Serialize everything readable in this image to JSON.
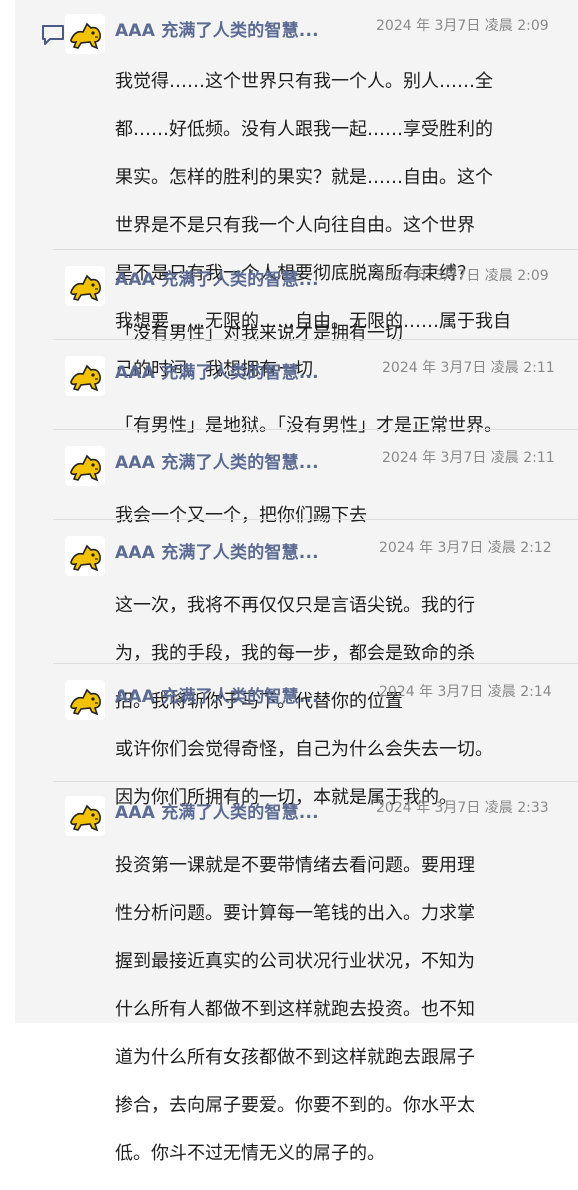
{
  "sender_name": "AAA 充满了人类的智慧...",
  "messages": [
    {
      "time": "2024 年 3月7日 凌晨 2:09",
      "lines": [
        "我觉得……这个世界只有我一个人。别人……全",
        "都……好低频。没有人跟我一起……享受胜利的",
        "果实。怎样的胜利的果实？就是……自由。这个",
        "世界是不是只有我一个人向往自由。这个世界",
        "是不是只有我一个人想要彻底脱离所有束缚？",
        "我想要……无限的……自由。无限的……属于我自",
        "己的时间。我想拥有一切"
      ]
    },
    {
      "time": "2024 年 3月7日 凌晨 2:09",
      "lines": [
        "「没有男性」对我来说才是拥有一切"
      ]
    },
    {
      "time": "2024 年 3月7日 凌晨 2:11",
      "lines": [
        "「有男性」是地狱。「没有男性」才是正常世界。"
      ]
    },
    {
      "time": "2024 年 3月7日 凌晨 2:11",
      "lines": [
        "我会一个又一个，把你们踢下去"
      ]
    },
    {
      "time": "2024 年 3月7日 凌晨 2:12",
      "lines": [
        "这一次，我将不再仅仅只是言语尖锐。我的行",
        "为，我的手段，我的每一步，都会是致命的杀",
        "招。我将斩你于马下。代替你的位置"
      ]
    },
    {
      "time": "2024 年 3月7日 凌晨 2:14",
      "lines": [
        "或许你们会觉得奇怪，自己为什么会失去一切。",
        "因为你们所拥有的一切，本就是属于我的。"
      ]
    },
    {
      "time": "2024 年 3月7日 凌晨 2:33",
      "lines": [
        "投资第一课就是不要带情绪去看问题。要用理",
        "性分析问题。要计算每一笔钱的出入。力求掌",
        "握到最接近真实的公司状况行业状况，不知为",
        "什么所有人都做不到这样就跑去投资。也不知",
        "道为什么所有女孩都做不到这样就跑去跟屌子",
        "掺合，去向屌子要爱。你要不到的。你水平太",
        "低。你斗不过无情无义的屌子的。"
      ]
    }
  ],
  "icons": {
    "comment": "comment-bubble-icon",
    "avatar": "cartoon-cat-avatar"
  }
}
